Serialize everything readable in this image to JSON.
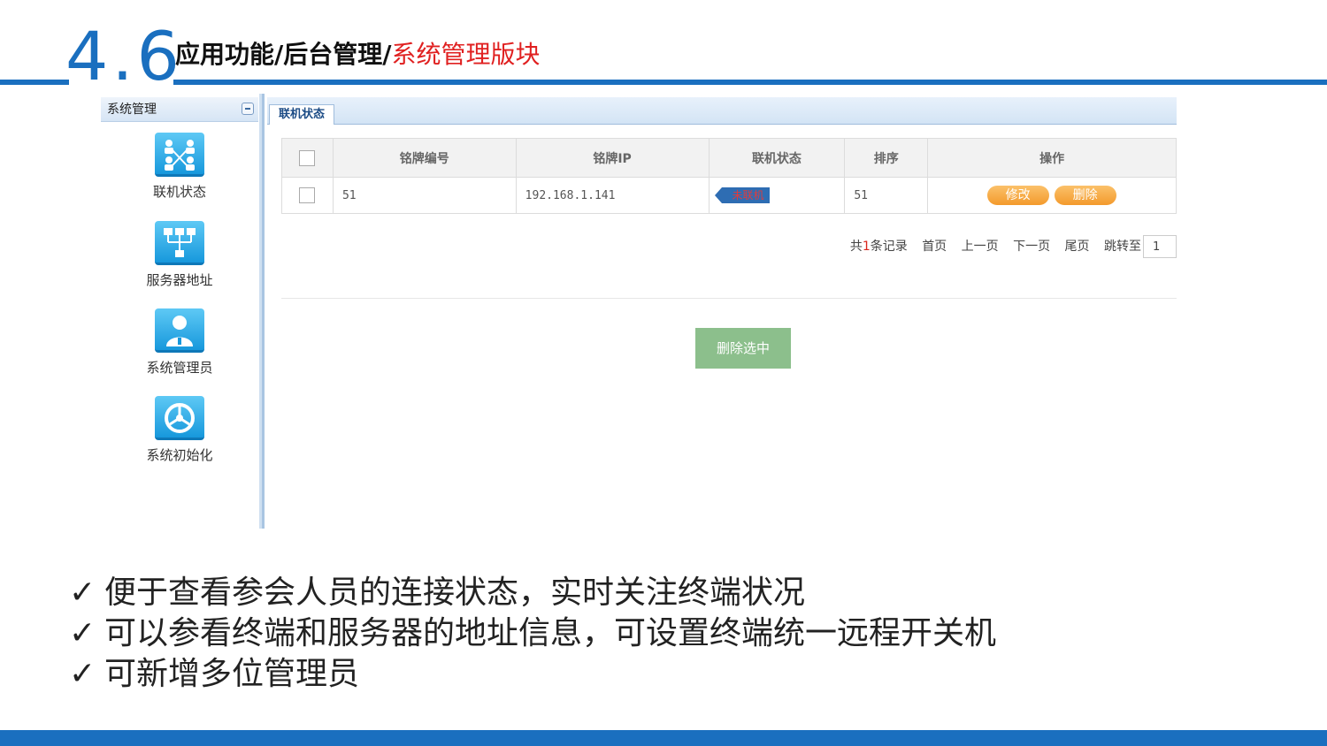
{
  "header": {
    "section_number": "4.6",
    "title_black": "应用功能/后台管理/",
    "title_red": "系统管理版块"
  },
  "sidebar": {
    "title": "系统管理",
    "items": [
      {
        "label": "联机状态",
        "icon": "network-users-icon"
      },
      {
        "label": "服务器地址",
        "icon": "server-tree-icon"
      },
      {
        "label": "系统管理员",
        "icon": "admin-user-icon"
      },
      {
        "label": "系统初始化",
        "icon": "gear-icon"
      }
    ]
  },
  "tab": {
    "label": "联机状态"
  },
  "table": {
    "columns": [
      "铭牌编号",
      "铭牌IP",
      "联机状态",
      "排序",
      "操作"
    ],
    "rows": [
      {
        "id": "51",
        "ip": "192.168.1.141",
        "status": "未联机",
        "sort": "51",
        "edit": "修改",
        "delete": "删除"
      }
    ]
  },
  "pager": {
    "total_prefix": "共",
    "total_count": "1",
    "total_suffix": "条记录",
    "first": "首页",
    "prev": "上一页",
    "next": "下一页",
    "last": "尾页",
    "jump_label": "跳转至",
    "jump_value": "1"
  },
  "actions": {
    "delete_selected": "删除选中"
  },
  "bullets": [
    "便于查看参会人员的连接状态，实时关注终端状况",
    "可以参看终端和服务器的地址信息，可设置终端统一远程开关机",
    "可新增多位管理员"
  ],
  "bullet_mark": "✓",
  "colors": {
    "brand_blue": "#1a6fbf",
    "title_red": "#e02020",
    "action_orange": "#f39a2c",
    "delete_selected_green": "#8cbf8c"
  }
}
